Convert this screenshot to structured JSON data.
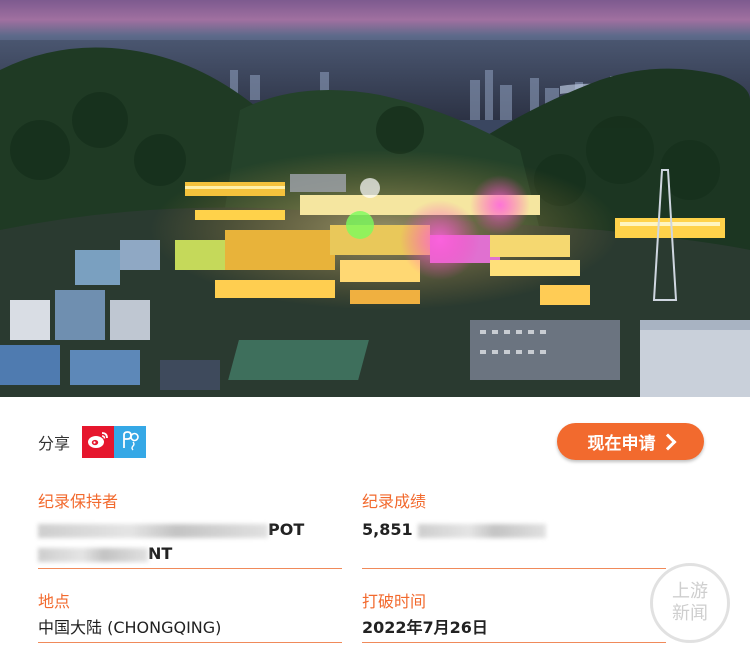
{
  "share": {
    "label": "分享",
    "weibo_icon": "weibo-icon",
    "second_icon": "moments-icon"
  },
  "apply_button": {
    "label": "现在申请"
  },
  "record_holder": {
    "label": "纪录保持者",
    "line1_suffix": "POT",
    "line2_suffix": "NT"
  },
  "record_result": {
    "label": "纪录成绩",
    "value_prefix": "5,851"
  },
  "location": {
    "label": "地点",
    "value": "中国大陆 (CHONGQING)"
  },
  "break_time": {
    "label": "打破时间",
    "value": "2022年7月26日"
  },
  "watermark": {
    "line1": "上游",
    "line2": "新闻"
  },
  "colors": {
    "accent": "#f26a2e",
    "weibo": "#e6162d",
    "share_blue": "#35a8e6"
  }
}
